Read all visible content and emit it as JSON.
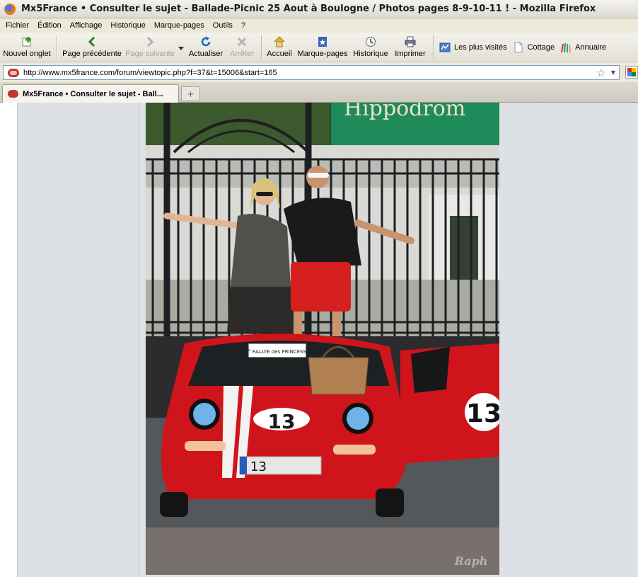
{
  "window": {
    "title": "Mx5France • Consulter le sujet - Ballade-Picnic 25 Aout à Boulogne / Photos pages 8-9-10-11 ! - Mozilla Firefox"
  },
  "menu": [
    {
      "label": "Fichier"
    },
    {
      "label": "Édition"
    },
    {
      "label": "Affichage"
    },
    {
      "label": "Historique"
    },
    {
      "label": "Marque-pages"
    },
    {
      "label": "Outils"
    },
    {
      "label": "?"
    }
  ],
  "toolbar": {
    "new_tab": "Nouvel onglet",
    "back": "Page précédente",
    "forward": "Page suivante",
    "reload": "Actualiser",
    "stop": "Arrêter",
    "home": "Accueil",
    "bookmarks": "Marque-pages",
    "history": "Historique",
    "print": "Imprimer"
  },
  "bookmarks_bar": [
    {
      "label": "Les plus visités",
      "icon": "most-visited-icon"
    },
    {
      "label": "Cottage",
      "icon": "page-icon"
    },
    {
      "label": "Annuaire",
      "icon": "directory-icon"
    }
  ],
  "address": {
    "url": "http://www.mx5france.com/forum/viewtopic.php?f=37&t=15006&start=165"
  },
  "tabs": [
    {
      "label": "Mx5France • Consulter le sujet - Ball..."
    }
  ],
  "content": {
    "photo": {
      "sign_text": "Hippodrom",
      "car_number": "13",
      "rally_plate": "13° RALLYE des PRINCESSES",
      "license_plate": "13",
      "watermark": "Raph"
    }
  },
  "colors": {
    "car_red": "#d0141b",
    "sign_green": "#1f8a5a",
    "page_bg": "#dde1e6"
  }
}
